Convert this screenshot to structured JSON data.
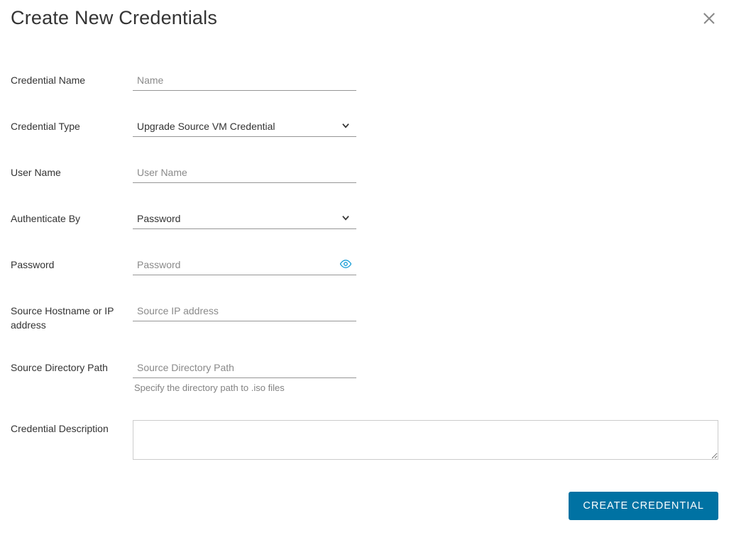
{
  "title": "Create New Credentials",
  "fields": {
    "credential_name": {
      "label": "Credential Name",
      "placeholder": "Name"
    },
    "credential_type": {
      "label": "Credential Type",
      "value": "Upgrade Source VM Credential"
    },
    "user_name": {
      "label": "User Name",
      "placeholder": "User Name"
    },
    "authenticate_by": {
      "label": "Authenticate By",
      "value": "Password"
    },
    "password": {
      "label": "Password",
      "placeholder": "Password"
    },
    "source_host": {
      "label": "Source Hostname or IP address",
      "placeholder": "Source IP address"
    },
    "source_dir": {
      "label": "Source Directory Path",
      "placeholder": "Source Directory Path",
      "hint": "Specify the directory path to .iso files"
    },
    "description": {
      "label": "Credential Description"
    }
  },
  "buttons": {
    "create": "CREATE CREDENTIAL"
  }
}
